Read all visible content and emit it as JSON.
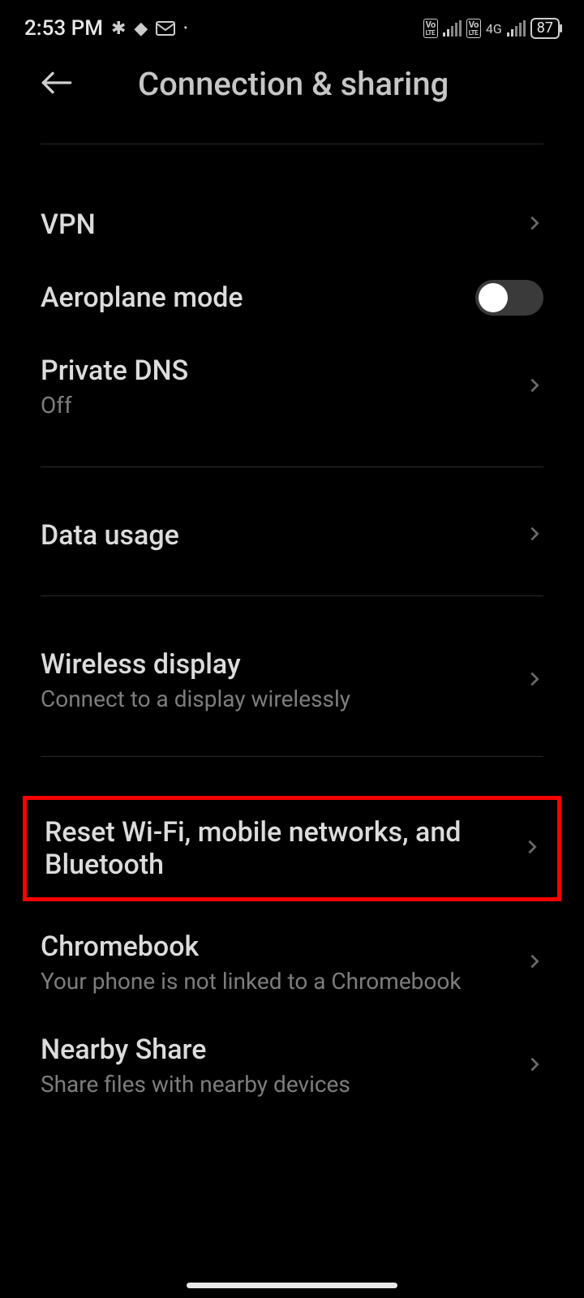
{
  "statusbar": {
    "time": "2:53 PM",
    "battery": "87",
    "net_type": "4G"
  },
  "header": {
    "title": "Connection & sharing"
  },
  "rows": {
    "vpn": {
      "label": "VPN"
    },
    "aeroplane": {
      "label": "Aeroplane mode",
      "toggle_on": false
    },
    "privatedns": {
      "label": "Private DNS",
      "sub": "Off"
    },
    "datausage": {
      "label": "Data usage"
    },
    "wirelessdisplay": {
      "label": "Wireless display",
      "sub": "Connect to a display wirelessly"
    },
    "reset": {
      "label": "Reset Wi-Fi, mobile networks, and Bluetooth"
    },
    "chromebook": {
      "label": "Chromebook",
      "sub": "Your phone is not linked to a Chromebook"
    },
    "nearbyshare": {
      "label": "Nearby Share",
      "sub": "Share files with nearby devices"
    }
  }
}
